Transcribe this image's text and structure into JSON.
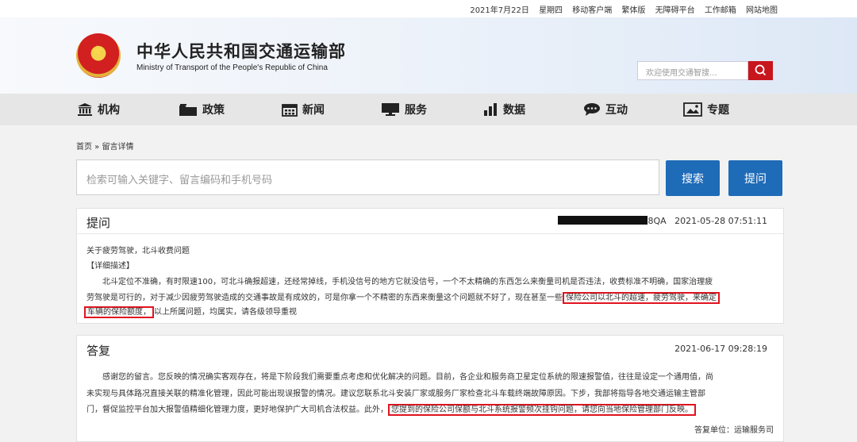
{
  "topbar": {
    "date": "2021年7月22日",
    "weekday": "星期四",
    "links": [
      "移动客户端",
      "繁体版",
      "无障碍平台",
      "工作邮箱",
      "网站地图"
    ]
  },
  "header": {
    "title": "中华人民共和国交通运输部",
    "subtitle": "Ministry of Transport of the People's Republic of China",
    "search_placeholder": "欢迎使用交通智搜..."
  },
  "nav": [
    {
      "label": "机构",
      "icon": "institution-icon"
    },
    {
      "label": "政策",
      "icon": "folder-icon"
    },
    {
      "label": "新闻",
      "icon": "calendar-icon"
    },
    {
      "label": "服务",
      "icon": "monitor-icon"
    },
    {
      "label": "数据",
      "icon": "bar-chart-icon"
    },
    {
      "label": "互动",
      "icon": "chat-icon"
    },
    {
      "label": "专题",
      "icon": "image-icon"
    }
  ],
  "breadcrumb": "首页 » 留言详情",
  "search": {
    "placeholder": "检索可输入关键字、留言编码和手机号码",
    "search_label": "搜索",
    "ask_label": "提问"
  },
  "question": {
    "heading": "提问",
    "code_suffix": "8QA",
    "datetime": "2021-05-28 07:51:11",
    "subject": "关于疲劳驾驶，北斗收费问题",
    "detail_label": "【详细描述】",
    "line1": "北斗定位不准确，有时限速100，可北斗确报超速，还经常掉线，手机没信号的地方它就没信号，一个不太精确的东西怎么来衡量司机是否违法，收费标准不明确，国家治理疲",
    "line2a": "劳驾驶是可行的，对于减少因疲劳驾驶造成的交通事故是有成效的，可是你拿一个不精密的东西来衡量这个问题就不好了，现在甚至一些",
    "line2_highlight": "保险公司以北斗的超速，疲劳驾驶，来确定",
    "line3_highlight": "车辆的保险额度，",
    "line3b": "以上所属问题，均属实，请各级领导重视"
  },
  "answer": {
    "heading": "答复",
    "datetime": "2021-06-17 09:28:19",
    "line1": "感谢您的留言。您反映的情况确实客观存在，将是下阶段我们需要重点考虑和优化解决的问题。目前，各企业和服务商卫星定位系统的限速报警值，往往是设定一个通用值，尚",
    "line2": "未实现与具体路况直接关联的精准化管理，因此可能出现误报警的情况。建议您联系北斗安装厂家或服务厂家检查北斗车载终端故障原因。下步，我部将指导各地交通运输主管部",
    "line3a": "门，督促监控平台加大报警值精细化管理力度，更好地保护广大司机合法权益。此外，",
    "line3_highlight": "您提到的保险公司保额与北斗系统报警频次挂钩问题，请您向当地保险管理部门反映。",
    "signature": "答复单位：运输服务司"
  }
}
